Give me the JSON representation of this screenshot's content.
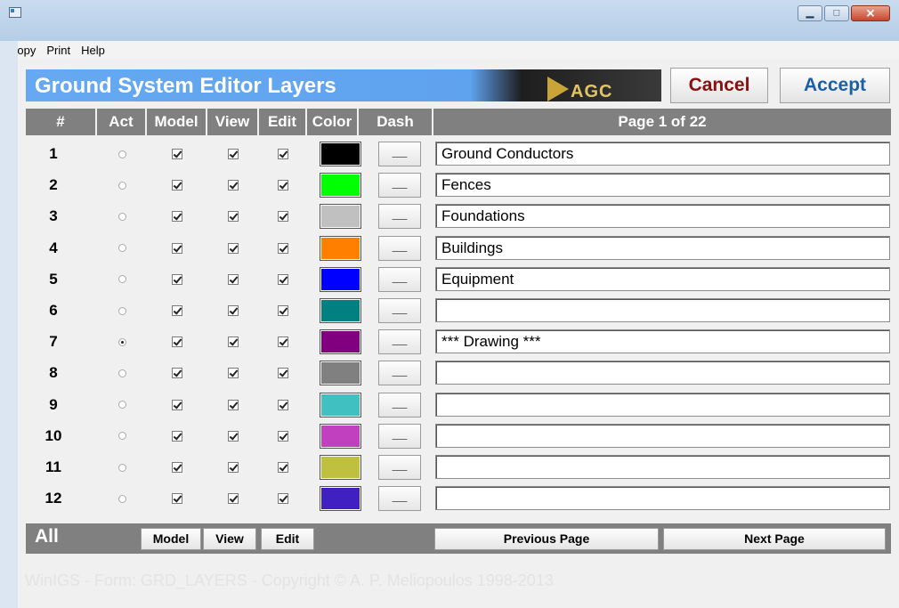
{
  "window": {
    "icon": "app-window-icon",
    "buttons": {
      "minimize": "▁",
      "maximize": "□",
      "close": "✕"
    }
  },
  "menu": [
    "Copy",
    "Print",
    "Help"
  ],
  "header": {
    "title": "Ground System Editor Layers",
    "logo_text": "AGC",
    "cancel": "Cancel",
    "accept": "Accept"
  },
  "columns": {
    "num": "#",
    "act": "Act",
    "model": "Model",
    "view": "View",
    "edit": "Edit",
    "color": "Color",
    "dash": "Dash",
    "page": "Page 1 of 22"
  },
  "rows": [
    {
      "num": "1",
      "active": false,
      "model": true,
      "view": true,
      "edit": true,
      "color": "#000000",
      "dash": "__",
      "name": "Ground Conductors"
    },
    {
      "num": "2",
      "active": false,
      "model": true,
      "view": true,
      "edit": true,
      "color": "#00ff00",
      "dash": "__",
      "name": "Fences"
    },
    {
      "num": "3",
      "active": false,
      "model": true,
      "view": true,
      "edit": true,
      "color": "#c0c0c0",
      "dash": "__",
      "name": "Foundations"
    },
    {
      "num": "4",
      "active": false,
      "model": true,
      "view": true,
      "edit": true,
      "color": "#ff8000",
      "dash": "__",
      "name": "Buildings"
    },
    {
      "num": "5",
      "active": false,
      "model": true,
      "view": true,
      "edit": true,
      "color": "#0000ff",
      "dash": "__",
      "name": "Equipment"
    },
    {
      "num": "6",
      "active": false,
      "model": true,
      "view": true,
      "edit": true,
      "color": "#008080",
      "dash": "__",
      "name": ""
    },
    {
      "num": "7",
      "active": true,
      "model": true,
      "view": true,
      "edit": true,
      "color": "#800080",
      "dash": "__",
      "name": "*** Drawing ***"
    },
    {
      "num": "8",
      "active": false,
      "model": true,
      "view": true,
      "edit": true,
      "color": "#808080",
      "dash": "__",
      "name": ""
    },
    {
      "num": "9",
      "active": false,
      "model": true,
      "view": true,
      "edit": true,
      "color": "#40c0c0",
      "dash": "__",
      "name": ""
    },
    {
      "num": "10",
      "active": false,
      "model": true,
      "view": true,
      "edit": true,
      "color": "#c040c0",
      "dash": "__",
      "name": ""
    },
    {
      "num": "11",
      "active": false,
      "model": true,
      "view": true,
      "edit": true,
      "color": "#c0c040",
      "dash": "__",
      "name": ""
    },
    {
      "num": "12",
      "active": false,
      "model": true,
      "view": true,
      "edit": true,
      "color": "#4020c0",
      "dash": "__",
      "name": ""
    }
  ],
  "footer": {
    "all": "All",
    "model": "Model",
    "view": "View",
    "edit": "Edit",
    "prev": "Previous Page",
    "next": "Next Page"
  },
  "copyright": "WinIGS - Form: GRD_LAYERS - Copyright © A. P. Meliopoulos 1998-2013"
}
